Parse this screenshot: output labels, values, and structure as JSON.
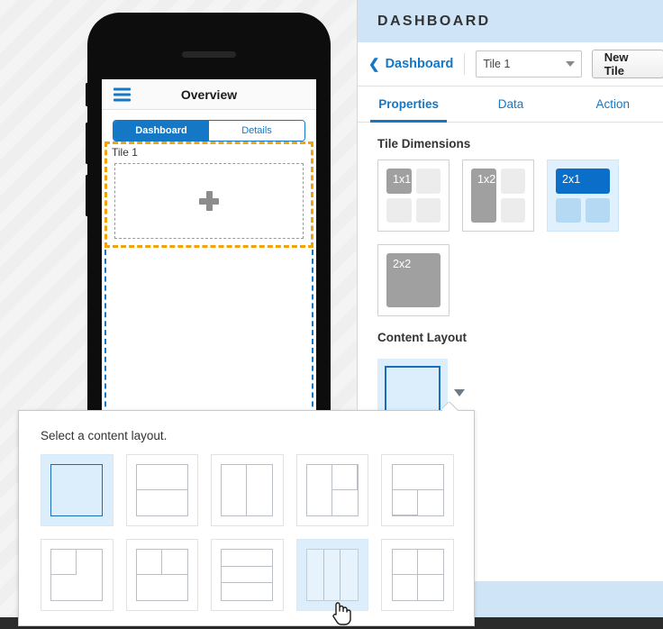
{
  "phone": {
    "navbar": {
      "title": "Overview",
      "menu_icon": "hamburger-menu-icon"
    },
    "segmented": {
      "options": [
        "Dashboard",
        "Details"
      ],
      "selected": "Dashboard"
    },
    "tile": {
      "label": "Tile 1",
      "add_icon": "plus-icon"
    }
  },
  "panel": {
    "header": {
      "title": "DASHBOARD"
    },
    "breadcrumb": {
      "back_icon": "chevron-left-icon",
      "label": "Dashboard"
    },
    "tile_select": {
      "value": "Tile 1",
      "caret_icon": "chevron-down-icon"
    },
    "new_tile_button": "New Tile",
    "tabs": [
      {
        "label": "Properties",
        "active": true
      },
      {
        "label": "Data",
        "active": false
      },
      {
        "label": "Action",
        "active": false
      }
    ],
    "tile_dimensions": {
      "title": "Tile Dimensions",
      "options": [
        {
          "label": "1x1",
          "selected": false
        },
        {
          "label": "1x2",
          "selected": false
        },
        {
          "label": "2x1",
          "selected": true
        },
        {
          "label": "2x2",
          "selected": false
        }
      ]
    },
    "content_layout": {
      "title": "Content Layout",
      "dropdown_icon": "chevron-down-icon"
    }
  },
  "popup": {
    "prompt": "Select a content layout.",
    "layouts": [
      {
        "name": "single",
        "selected": true,
        "hover": false
      },
      {
        "name": "two-rows",
        "selected": false,
        "hover": false
      },
      {
        "name": "two-columns",
        "selected": false,
        "hover": false
      },
      {
        "name": "left-full-right-split",
        "selected": false,
        "hover": false
      },
      {
        "name": "top-full-bottom-split",
        "selected": false,
        "hover": false
      },
      {
        "name": "left-split-right-full",
        "selected": false,
        "hover": false
      },
      {
        "name": "top-split-bottom-full",
        "selected": false,
        "hover": false
      },
      {
        "name": "three-rows",
        "selected": false,
        "hover": false
      },
      {
        "name": "three-columns",
        "selected": false,
        "hover": true
      },
      {
        "name": "quad",
        "selected": false,
        "hover": false
      }
    ]
  },
  "cursor": {
    "icon": "hand-pointer-cursor"
  },
  "colors": {
    "accent_blue": "#1478c6",
    "header_blue": "#cfe5f7",
    "selected_blue": "#0b6fc9",
    "light_blue": "#b5d9f3",
    "selection_orange": "#f0a30a",
    "gray_cell": "#a0a0a0"
  }
}
